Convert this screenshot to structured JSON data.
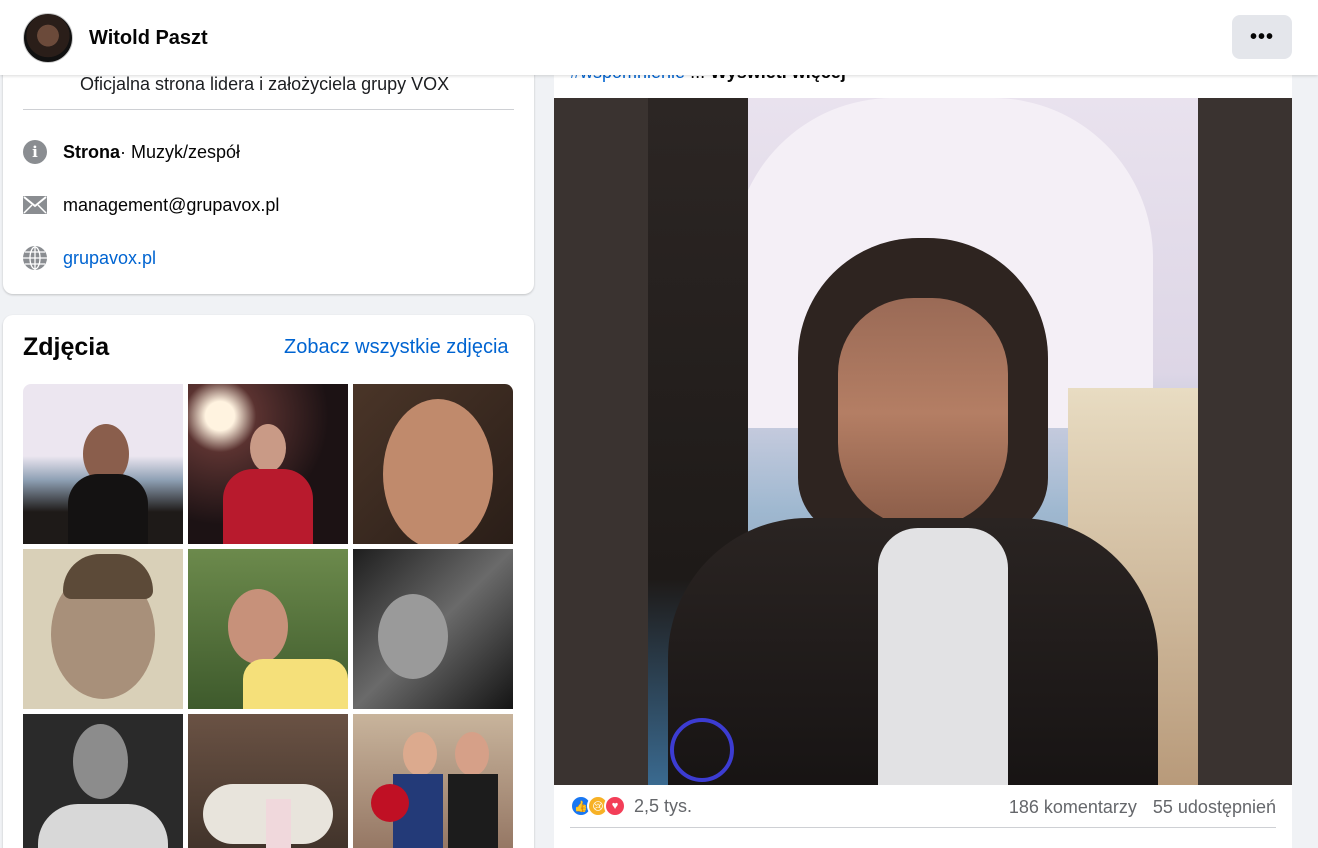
{
  "header": {
    "page_name": "Witold Paszt",
    "more_label": "•••"
  },
  "intro": {
    "description": "Oficjalna strona lidera i założyciela grupy VOX",
    "category_label": "Strona",
    "category_value": " · Muzyk/zespół",
    "email": "management@grupavox.pl",
    "website": "grupavox.pl",
    "icons": [
      "info-icon",
      "mail-icon",
      "globe-icon"
    ]
  },
  "photos": {
    "title": "Zdjęcia",
    "see_all": "Zobacz wszystkie zdjęcia"
  },
  "post": {
    "hashtag": "#wspomnienie",
    "ellipsis": " ... ",
    "see_more": "Wyświetl więcej",
    "reactions_count": "2,5 tys.",
    "comments": "186 komentarzy",
    "shares": "55 udostępnień",
    "colors": {
      "accent": "#0064d1",
      "like": "#1877f2",
      "love": "#f33e58",
      "sad": "#f7b125"
    }
  }
}
